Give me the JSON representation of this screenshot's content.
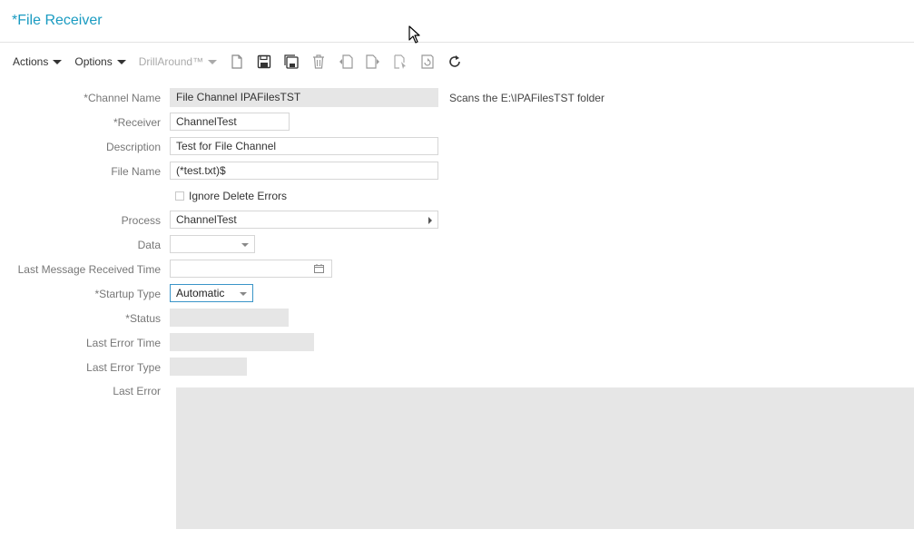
{
  "header": {
    "title": "*File Receiver"
  },
  "toolbar": {
    "actions_label": "Actions",
    "options_label": "Options",
    "drill_label": "DrillAround™",
    "icons": [
      "new-document-icon",
      "save-icon",
      "save-as-icon",
      "delete-icon",
      "previous-record-icon",
      "next-record-icon",
      "select-icon",
      "refresh-view-icon",
      "reload-icon"
    ]
  },
  "form": {
    "channel_name": {
      "label": "*Channel Name",
      "value": "File Channel IPAFilesTST",
      "note": "Scans the E:\\IPAFilesTST folder"
    },
    "receiver": {
      "label": "*Receiver",
      "value": "ChannelTest"
    },
    "description": {
      "label": "Description",
      "value": "Test for File Channel"
    },
    "file_name": {
      "label": "File Name",
      "value": "(*test.txt)$"
    },
    "ignore_delete_errors": {
      "label": "Ignore Delete Errors",
      "checked": false
    },
    "process": {
      "label": "Process",
      "value": "ChannelTest"
    },
    "data": {
      "label": "Data",
      "value": ""
    },
    "last_message_received_time": {
      "label": "Last Message Received Time",
      "value": ""
    },
    "startup_type": {
      "label": "*Startup Type",
      "value": "Automatic"
    },
    "status": {
      "label": "*Status",
      "value": ""
    },
    "last_error_time": {
      "label": "Last Error Time",
      "value": ""
    },
    "last_error_type": {
      "label": "Last Error Type",
      "value": ""
    },
    "last_error": {
      "label": "Last Error",
      "value": ""
    }
  },
  "colors": {
    "title": "#1a9bc1",
    "focus_border": "#3a95c8",
    "readonly_bg": "#e6e6e6"
  }
}
